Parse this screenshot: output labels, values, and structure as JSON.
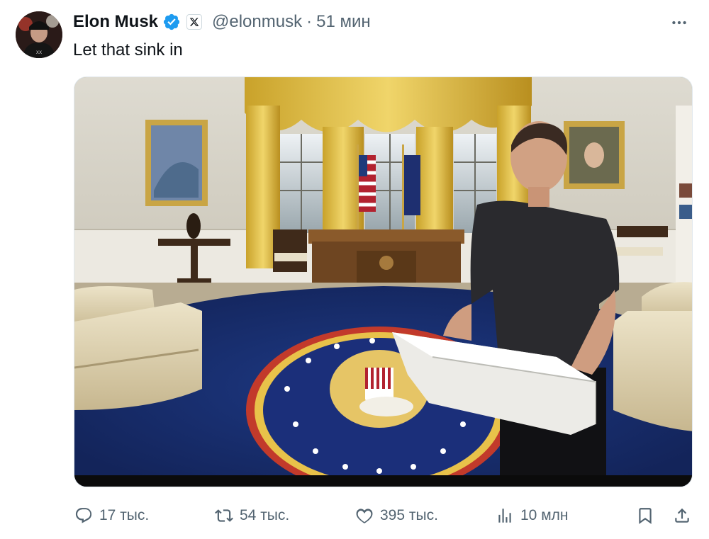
{
  "author": {
    "display_name": "Elon Musk",
    "handle": "@elonmusk",
    "separator": "·",
    "timestamp": "51 мин"
  },
  "tweet": {
    "text": "Let that sink in"
  },
  "actions": {
    "replies": "17 тыс.",
    "reposts": "54 тыс.",
    "likes": "395 тыс.",
    "views": "10 млн"
  },
  "colors": {
    "verified": "#1d9bf0",
    "muted_text": "#536471",
    "primary_text": "#0f1419"
  },
  "icons": {
    "verified": "verified-badge-icon",
    "affiliate": "x-logo-icon",
    "more": "more-dots-icon",
    "reply": "reply-bubble-icon",
    "repost": "repost-arrows-icon",
    "like": "heart-icon",
    "views": "views-bars-icon",
    "bookmark": "bookmark-icon",
    "share": "share-upload-icon"
  }
}
